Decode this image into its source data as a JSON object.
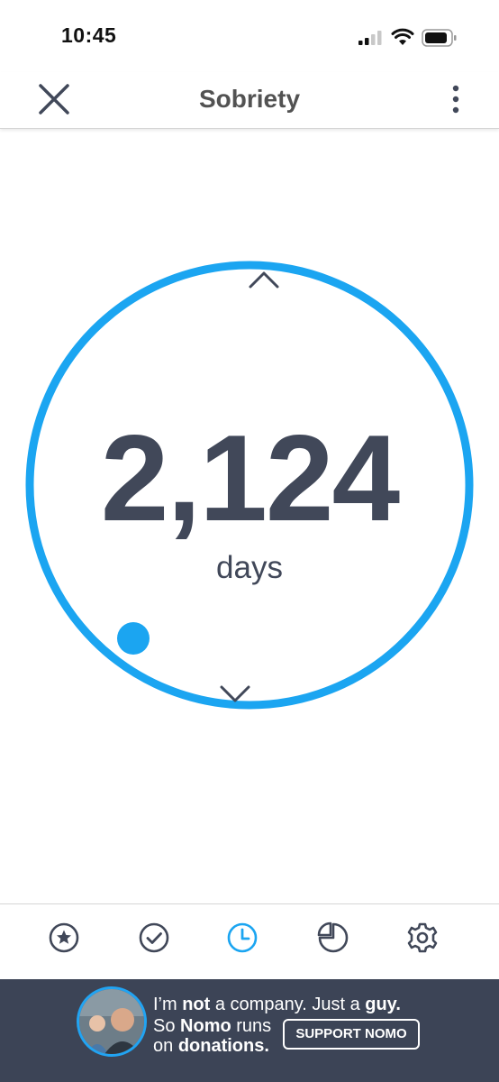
{
  "status_bar": {
    "time": "10:45"
  },
  "nav": {
    "title": "Sobriety"
  },
  "counter": {
    "value": "2,124",
    "unit": "days"
  },
  "ring": {
    "color": "#1ba5f1"
  },
  "tabs": [
    {
      "icon": "star-icon",
      "active": false
    },
    {
      "icon": "check-icon",
      "active": false
    },
    {
      "icon": "clock-icon",
      "active": true
    },
    {
      "icon": "pie-chart-icon",
      "active": false
    },
    {
      "icon": "gear-icon",
      "active": false
    }
  ],
  "banner": {
    "line1_a": "I’m ",
    "line1_b": "not",
    "line1_c": " a company. Just a ",
    "line1_d": "guy.",
    "line2_a": "So ",
    "line2_b": "Nomo",
    "line2_c": " runs",
    "line3_a": "on ",
    "line3_b": "donations.",
    "button": "SUPPORT NOMO"
  },
  "colors": {
    "accent": "#1ba5f1",
    "text": "#414859",
    "banner_bg": "#3c4456"
  }
}
